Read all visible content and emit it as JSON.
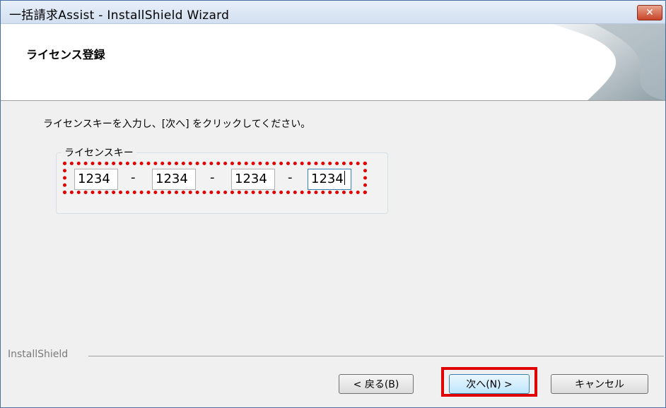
{
  "window": {
    "title": "一括請求Assist - InstallShield Wizard",
    "close_label": "✕"
  },
  "header": {
    "title": "ライセンス登録"
  },
  "main": {
    "instruction": "ライセンスキーを入力し、[次へ] をクリックしてください。",
    "group_label": "ライセンスキー",
    "key_fields": [
      "1234",
      "1234",
      "1234",
      "1234"
    ],
    "separator": "-"
  },
  "footer": {
    "brand": "InstallShield"
  },
  "buttons": {
    "back": "< 戻る(B)",
    "next": "次へ(N) >",
    "cancel": "キャンセル"
  },
  "colors": {
    "highlight": "#e00000",
    "accent": "#3c7fb1"
  }
}
